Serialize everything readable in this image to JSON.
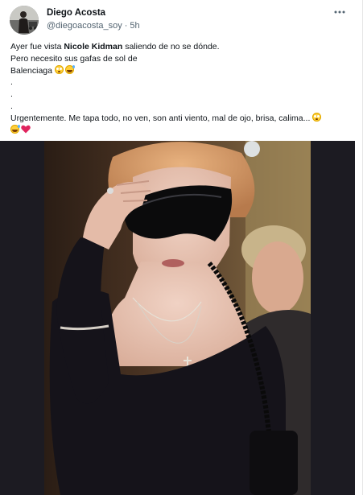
{
  "tweet": {
    "author": {
      "name": "Diego Acosta",
      "handle": "@diegoacosta_soy",
      "separator": "·",
      "time": "5h",
      "avatar_icon": "profile-photo"
    },
    "more_icon": "more-horizontal-icon",
    "text": {
      "line1_prefix": "Ayer fue vista ",
      "line1_bold": "Nicole Kidman",
      "line1_suffix": " saliendo de no se dónde.",
      "line2": "Pero necesito sus gafas de sol de",
      "line3": "Balenciaga",
      "line4": ".",
      "line5": ".",
      "line6": ".",
      "line7": "Urgentemente. Me tapa todo, no ven, son anti viento, mal de ojo, brisa, calima..."
    },
    "emojis": {
      "flushed": "flushed-face-emoji",
      "sweat_smile": "grinning-sweat-emoji",
      "heart": "red-heart-emoji"
    },
    "media": {
      "description_icon": "photo-image",
      "background_color": "#1c1b22"
    }
  },
  "colors": {
    "text": "#0f1419",
    "secondary": "#536471",
    "heart": "#e0245e"
  }
}
